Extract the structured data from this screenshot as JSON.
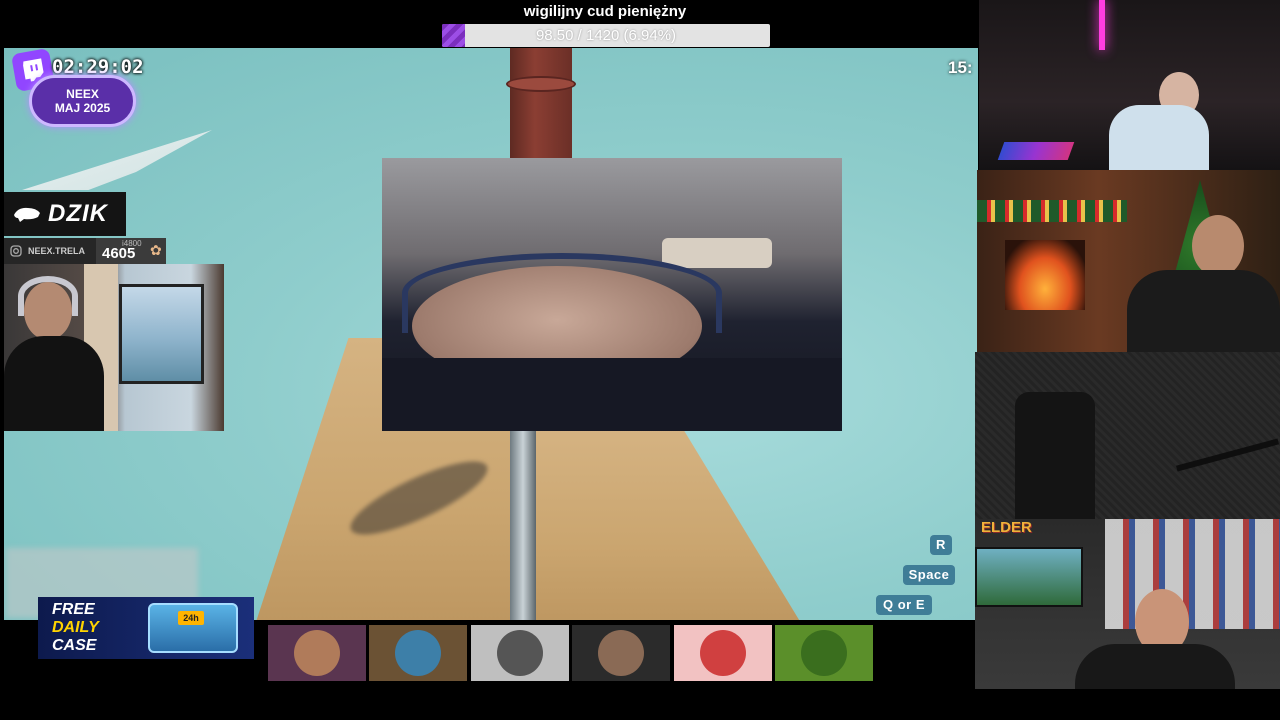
{
  "goal": {
    "title": "wigilijny cud pieniężny",
    "progress_text": "98.50 / 1420 (6.94%)",
    "progress_fraction": 0.0694,
    "fill_color": "#8a3fd6"
  },
  "overlay": {
    "uptime": "02:29:02",
    "clock_right": "15:",
    "sub_badge": {
      "line1": "NEEX",
      "line2": "MAJ 2025"
    },
    "sponsor": "DZIK",
    "social_handle": "NEEX.TRELA",
    "counter_small": "i4800",
    "counter_big": "4605",
    "twitch_icon": "twitch-icon",
    "instagram_icon": "instagram-icon",
    "muscle_icon": "flexed-biceps-icon"
  },
  "controls": {
    "key1": "R",
    "key2": "Space",
    "key3": "Q or E"
  },
  "promo": {
    "line1": "FREE",
    "line2": "DAILY",
    "line3": "CASE",
    "chest_label": "24h"
  },
  "cams": {
    "elder_logo": "ELDER"
  },
  "tiles": [
    {
      "name": "tile-1",
      "bg": "#5a3550",
      "avatar": "#b07b5a"
    },
    {
      "name": "tile-2",
      "bg": "#6b5234",
      "avatar": "#3d7fa8"
    },
    {
      "name": "tile-3",
      "bg": "#bfbfbf",
      "avatar": "#555555"
    },
    {
      "name": "tile-4",
      "bg": "#2b2b2b",
      "avatar": "#8a6a55"
    },
    {
      "name": "tile-5",
      "bg": "#f2c2c2",
      "avatar": "#d04040"
    },
    {
      "name": "tile-6",
      "bg": "#5b8f2a",
      "avatar": "#3a6e1e"
    }
  ]
}
